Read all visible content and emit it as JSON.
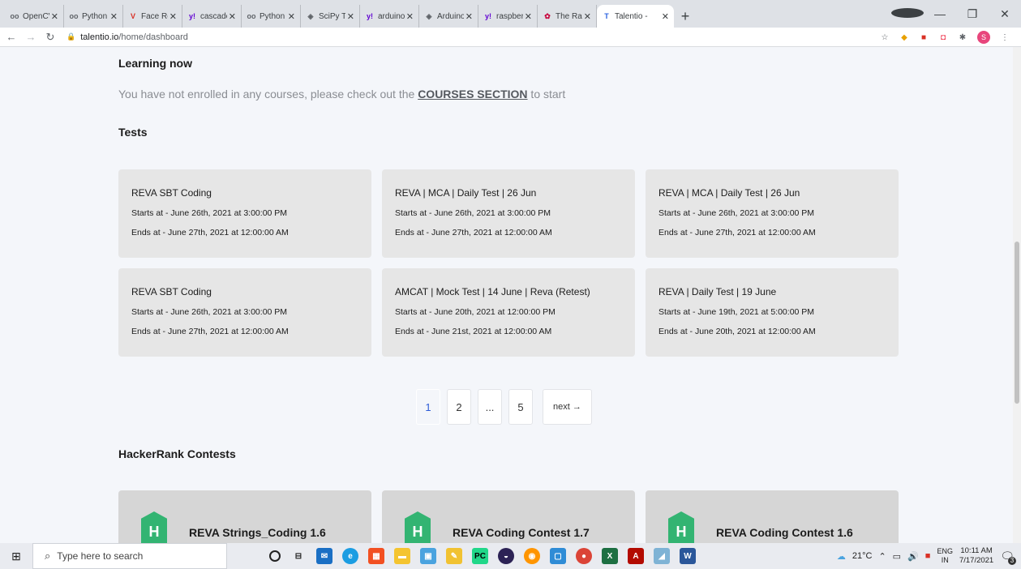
{
  "browser": {
    "tabs": [
      {
        "title": "OpenCV I",
        "favicon": "oo",
        "color": "#5f6368"
      },
      {
        "title": "Python Op",
        "favicon": "oo",
        "color": "#5f6368"
      },
      {
        "title": "Face Reco",
        "favicon": "V",
        "color": "#d93025"
      },
      {
        "title": "cascade f",
        "favicon": "y!",
        "color": "#6001d2"
      },
      {
        "title": "Python |",
        "favicon": "oo",
        "color": "#5f6368"
      },
      {
        "title": "SciPy Tut",
        "favicon": "◈",
        "color": "#5f6368"
      },
      {
        "title": "arduino t",
        "favicon": "y!",
        "color": "#6001d2"
      },
      {
        "title": "Arduino -",
        "favicon": "◈",
        "color": "#5f6368"
      },
      {
        "title": "raspberry",
        "favicon": "y!",
        "color": "#6001d2"
      },
      {
        "title": "The Raspb",
        "favicon": "✿",
        "color": "#c7053d"
      }
    ],
    "active_tab": {
      "title": "Talentio -",
      "favicon": "T",
      "color": "#2b62e0"
    },
    "new_tab": "+",
    "url_host": "talentio.io",
    "url_path": "/home/dashboard",
    "avatar_letter": "S"
  },
  "learning": {
    "heading": "Learning now",
    "message_prefix": "You have not enrolled in any courses, please check out the ",
    "link": "COURSES SECTION",
    "message_suffix": " to start"
  },
  "tests": {
    "heading": "Tests",
    "cards": [
      {
        "title": "REVA SBT Coding",
        "starts": "Starts at - June 26th, 2021 at 3:00:00 PM",
        "ends": "Ends at - June 27th, 2021 at 12:00:00 AM"
      },
      {
        "title": "REVA | MCA | Daily Test | 26 Jun",
        "starts": "Starts at - June 26th, 2021 at 3:00:00 PM",
        "ends": "Ends at - June 27th, 2021 at 12:00:00 AM"
      },
      {
        "title": "REVA | MCA | Daily Test | 26 Jun",
        "starts": "Starts at - June 26th, 2021 at 3:00:00 PM",
        "ends": "Ends at - June 27th, 2021 at 12:00:00 AM"
      },
      {
        "title": "REVA SBT Coding",
        "starts": "Starts at - June 26th, 2021 at 3:00:00 PM",
        "ends": "Ends at - June 27th, 2021 at 12:00:00 AM"
      },
      {
        "title": "AMCAT | Mock Test | 14 June | Reva (Retest)",
        "starts": "Starts at - June 20th, 2021 at 12:00:00 PM",
        "ends": "Ends at - June 21st, 2021 at 12:00:00 AM"
      },
      {
        "title": "REVA | Daily Test | 19 June",
        "starts": "Starts at - June 19th, 2021 at 5:00:00 PM",
        "ends": "Ends at - June 20th, 2021 at 12:00:00 AM"
      }
    ]
  },
  "pagination": {
    "pages": [
      "1",
      "2",
      "...",
      "5"
    ],
    "current": "1",
    "next": "next →"
  },
  "hackerrank": {
    "heading": "HackerRank Contests",
    "icon_letter": "H",
    "cards": [
      {
        "title": "REVA Strings_Coding 1.6"
      },
      {
        "title": "REVA Coding Contest 1.7"
      },
      {
        "title": "REVA Coding Contest 1.6"
      }
    ]
  },
  "taskbar": {
    "search_placeholder": "Type here to search",
    "weather": "21°C",
    "lang_top": "ENG",
    "lang_bottom": "IN",
    "time": "10:11 AM",
    "date": "7/17/2021",
    "notif_count": "3"
  }
}
